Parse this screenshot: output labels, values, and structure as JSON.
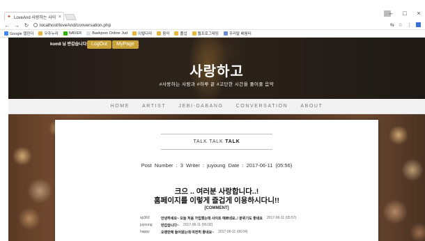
{
  "browser": {
    "tab_title": "LoveAnd 사랑하는 사이",
    "tab_close": "×",
    "url": "localhost/loveAnd/conversation.php",
    "bookmarks": [
      {
        "label": "Google 캘린더",
        "color": "#4285f4"
      },
      {
        "label": "우주누리",
        "color": "#e6b640"
      },
      {
        "label": "NAVER",
        "color": "#2db400"
      },
      {
        "label": "Baekjoon Online Jud",
        "color": "#e0e0e0"
      },
      {
        "label": "이렇다라",
        "color": "#e6b640"
      },
      {
        "label": "음악",
        "color": "#e6b640"
      },
      {
        "label": "졸업",
        "color": "#e6b640"
      },
      {
        "label": "웹프로그래밍",
        "color": "#e6b640"
      },
      {
        "label": "우리말 배움터",
        "color": "#6d8bd8"
      }
    ]
  },
  "header": {
    "login_info": "kom8 님 반갑습니다!",
    "logout_label": "LogOut",
    "mypage_label": "MyPage",
    "brand": "사랑하고",
    "tagline": "#사랑하는 사람과 #하루 끝 #고단한 시간을 풀어줄 음악"
  },
  "nav": {
    "items": [
      "HOME",
      "ARTIST",
      "JEBI-DABANG",
      "CONVERSATION",
      "ABOUT"
    ]
  },
  "post": {
    "section_prefix": "TALK TALK",
    "section_bold": "TALK",
    "meta": "Post Number : 3    Writer : juyoung    Date : 2017-06-11 (05:56)",
    "line1": "크으 .. 여러분 사랑합니다..!",
    "line2": "홈페이지를 이렇게 즐겁게 이용하시다니!!",
    "comment_header": "[COMMENT]",
    "comments": [
      {
        "writer": "sp369",
        "text": "안녕하세요~ 오늘 처음 가입했는데 사이트 예쁘네요..! 분위기도 좋네요",
        "date": "2017-06-11 (05:57)"
      },
      {
        "writer": "juyoung",
        "text": "반갑습니다~",
        "date": "2017-06-11 (06:02)"
      },
      {
        "writer": "happy",
        "text": "오랜만에 들어왔는데 여전히 좋네요~",
        "date": "2017-06-11 (06:04)"
      }
    ]
  }
}
